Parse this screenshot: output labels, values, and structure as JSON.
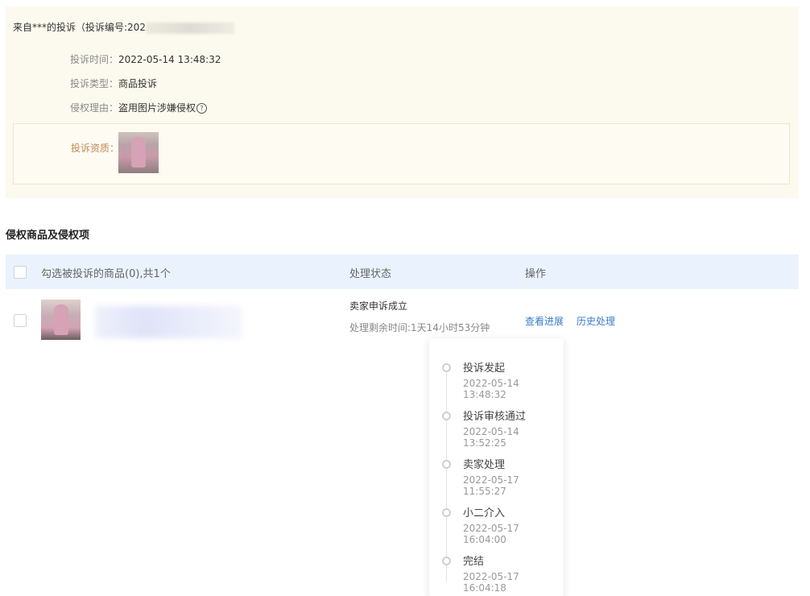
{
  "complaint": {
    "title_prefix": "来自***的投诉（投诉编号:202",
    "rows": [
      {
        "label": "投诉时间：",
        "value": "2022-05-14 13:48:32"
      },
      {
        "label": "投诉类型：",
        "value": "商品投诉"
      },
      {
        "label": "侵权理由：",
        "value": "盗用图片涉嫌侵权"
      }
    ],
    "qualification_label": "投诉资质："
  },
  "section": {
    "title": "侵权商品及侵权项"
  },
  "table": {
    "headers": {
      "select": "勾选被投诉的商品(0),共1个",
      "status": "处理状态",
      "action": "操作"
    },
    "row": {
      "status": "卖家申诉成立",
      "remaining": "处理剩余时间:1天14小时53分钟",
      "links": {
        "progress": "查看进展",
        "history": "历史处理"
      }
    }
  },
  "timeline": [
    {
      "title": "投诉发起",
      "time": "2022-05-14 13:48:32"
    },
    {
      "title": "投诉审核通过",
      "time": "2022-05-14 13:52:25"
    },
    {
      "title": "卖家处理",
      "time": "2022-05-17 11:55:27"
    },
    {
      "title": "小二介入",
      "time": "2022-05-17 16:04:00"
    },
    {
      "title": "完结",
      "time": "2022-05-17 16:04:18"
    }
  ],
  "icons": {
    "help": "help-circle-icon",
    "checkbox": "checkbox-icon",
    "timeline_dot": "timeline-dot-icon"
  },
  "colors": {
    "link": "#3a7bc8",
    "qualification_label": "#c08a57",
    "header_bg": "#eaf3fd",
    "panel_bg": "#fcfaee"
  }
}
